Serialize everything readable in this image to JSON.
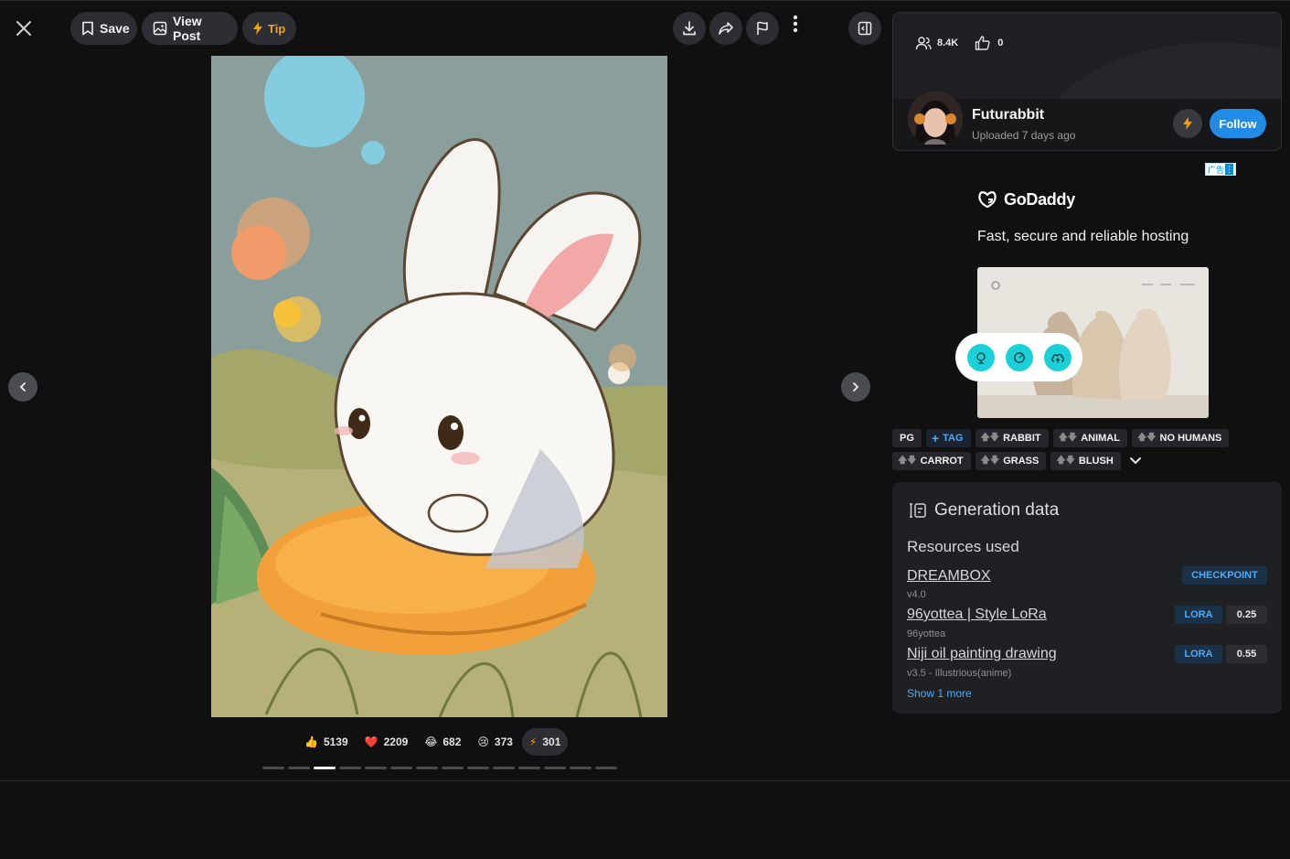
{
  "toolbar": {
    "save_label": "Save",
    "view_post_label": "View Post",
    "tip_label": "Tip"
  },
  "reactions": [
    {
      "emoji": "👍",
      "count": "5139"
    },
    {
      "emoji": "❤️",
      "count": "2209"
    },
    {
      "emoji": "😂",
      "count": "682"
    },
    {
      "emoji": "😢",
      "count": "373"
    },
    {
      "emoji": "⚡",
      "count": "301"
    }
  ],
  "pager": {
    "total": 14,
    "active_index": 2
  },
  "stats": {
    "viewers": "8.4K",
    "likes": "0"
  },
  "user": {
    "name": "Futurabbit",
    "uploaded": "Uploaded 7 days ago",
    "follow_label": "Follow"
  },
  "ad": {
    "marker": "广告",
    "brand": "GoDaddy",
    "tagline": "Fast, secure and reliable hosting"
  },
  "tags": {
    "rating": "PG",
    "add_label": "TAG",
    "items": [
      "RABBIT",
      "ANIMAL",
      "NO HUMANS",
      "CARROT",
      "GRASS",
      "BLUSH"
    ]
  },
  "generation": {
    "title": "Generation data",
    "resources_heading": "Resources used",
    "resources": [
      {
        "name": "DREAMBOX",
        "version": "v4.0",
        "type": "CHECKPOINT",
        "weight": ""
      },
      {
        "name": "96yottea | Style LoRa",
        "version": "96yottea",
        "type": "LORA",
        "weight": "0.25"
      },
      {
        "name": "Niji oil painting drawing",
        "version": "v3.5 - Illustrious(anime)",
        "type": "LORA",
        "weight": "0.55"
      }
    ],
    "show_more": "Show 1 more"
  },
  "colors": {
    "accent_blue": "#228be6",
    "tip_yellow": "#f59f00",
    "panel": "#1f2024"
  }
}
